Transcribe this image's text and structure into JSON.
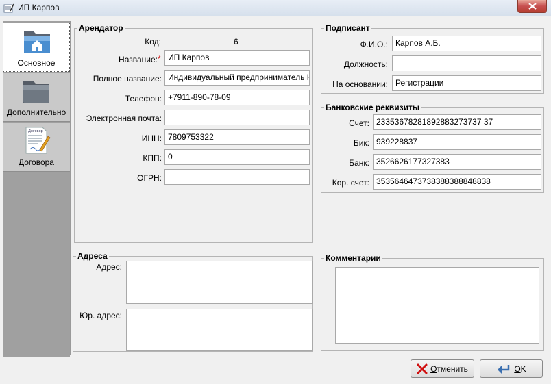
{
  "window": {
    "title": "ИП Карпов"
  },
  "nav": {
    "items": [
      {
        "label": "Основное",
        "active": true
      },
      {
        "label": "Дополнительно",
        "active": false
      },
      {
        "label": "Договора",
        "active": false
      }
    ],
    "contract_icon_text": "Договор"
  },
  "tenant": {
    "legend": "Арендатор",
    "code_label": "Код:",
    "code_value": "6",
    "name_label": "Название:",
    "name_required_mark": "*",
    "name_value": "ИП Карпов",
    "full_name_label": "Полное название:",
    "full_name_value": "Индивидуальный предприниматель К",
    "phone_label": "Телефон:",
    "phone_value": "+7911-890-78-09",
    "email_label": "Электронная почта:",
    "email_value": "",
    "inn_label": "ИНН:",
    "inn_value": "7809753322",
    "kpp_label": "КПП:",
    "kpp_value": "0",
    "ogrn_label": "ОГРН:",
    "ogrn_value": ""
  },
  "signatory": {
    "legend": "Подписант",
    "fio_label": "Ф.И.О.:",
    "fio_value": "Карпов А.Б.",
    "position_label": "Должность:",
    "position_value": "",
    "basis_label": "На основании:",
    "basis_value": "Регистрации"
  },
  "bank": {
    "legend": "Банковские реквизиты",
    "account_label": "Счет:",
    "account_value": "23353678281892883273737 37",
    "bik_label": "Бик:",
    "bik_value": "939228837",
    "bank_label": "Банк:",
    "bank_value": "3526626177327383",
    "corr_label": "Кор. счет:",
    "corr_value": "3535646473738388388848838"
  },
  "addresses": {
    "legend": "Адреса",
    "address_label": "Адрес:",
    "address_value": "",
    "legal_label": "Юр. адрес:",
    "legal_value": ""
  },
  "comments": {
    "legend": "Комментарии",
    "value": ""
  },
  "buttons": {
    "cancel_prefix": "О",
    "cancel_rest": "тменить",
    "ok_prefix": "O",
    "ok_rest": "K"
  }
}
